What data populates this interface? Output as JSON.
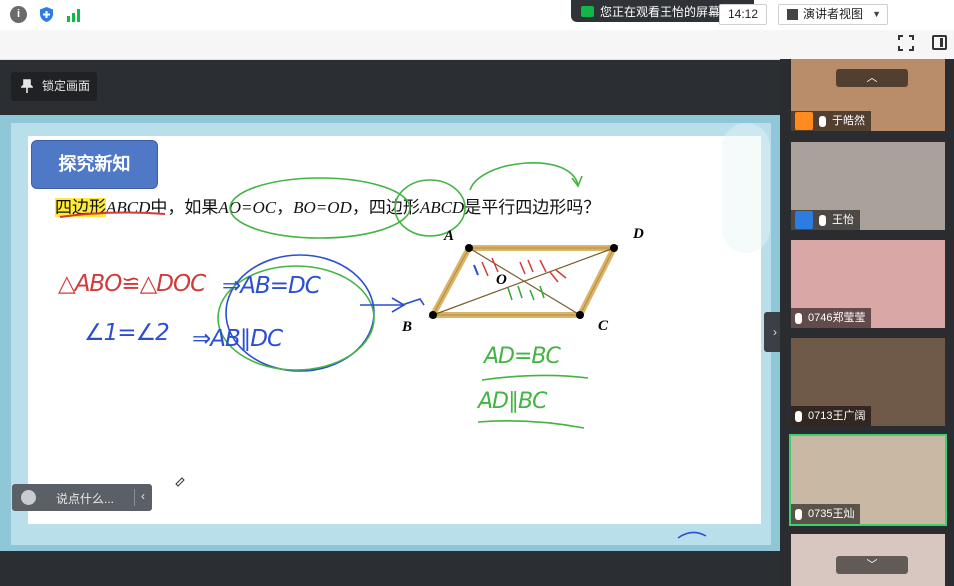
{
  "share_banner": {
    "text": "您正在观看王怡的屏幕",
    "menu_icon": "list-icon"
  },
  "toolbar": {
    "timer": "14:12",
    "view_mode": "演讲者视图"
  },
  "lock_button": {
    "label": "锁定画面"
  },
  "slide": {
    "badge": "探究新知",
    "question": {
      "highlight": "四边形",
      "name1": "ABCD",
      "mid1": "中，如果",
      "eq1": "AO=OC",
      "comma": "，",
      "eq2": "BO=OD",
      "mid2": "，四边形",
      "name2": "ABCD",
      "end": "是平行四边形吗？"
    },
    "labels": {
      "A": "A",
      "D": "D",
      "O": "O",
      "B": "B",
      "C": "C"
    },
    "handwriting": {
      "red1": "△ABO≌△DOC",
      "blue1": "⇒AB=DC",
      "blue2": "∠1=∠2",
      "blue3": "⇒AB∥DC",
      "green1": "AD=BC",
      "green2": "AD∥BC"
    }
  },
  "chat": {
    "placeholder": "说点什么..."
  },
  "participants": [
    {
      "name": "于皓然",
      "avatar": true,
      "avatar_color": "#ff8a1e"
    },
    {
      "name": "王怡",
      "avatar": true,
      "avatar_color": "#2d7ce0"
    },
    {
      "name": "0746郑莹莹",
      "avatar": false
    },
    {
      "name": "0713王广阔",
      "avatar": false
    },
    {
      "name": "0735王灿",
      "avatar": false,
      "active": true
    },
    {
      "name": "",
      "avatar": false
    }
  ],
  "colors": {
    "accent_green": "#12b74a",
    "badge_blue": "#4f79c7",
    "active_border": "#3bd16f"
  }
}
